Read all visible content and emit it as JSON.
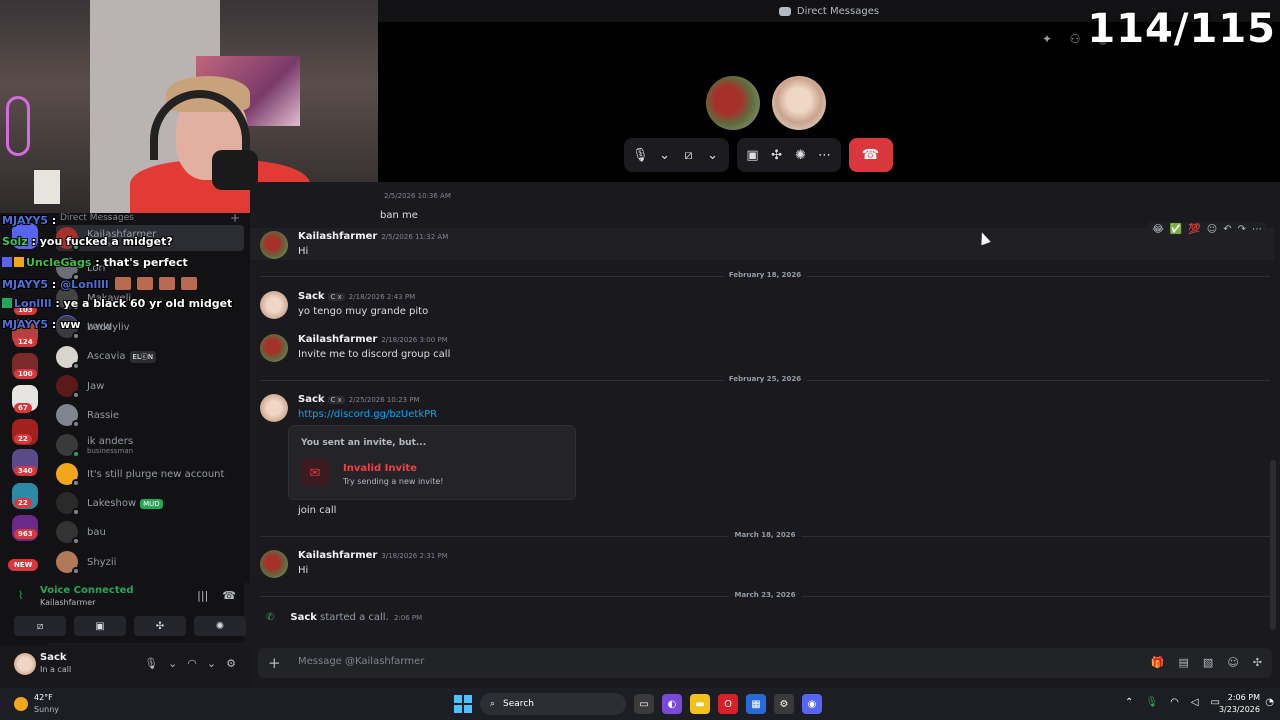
{
  "window": {
    "title": "Direct Messages",
    "counter": "114/115"
  },
  "dm_sidebar": {
    "header": "Direct Messages",
    "items": [
      {
        "name": "Kailashfarmer",
        "sub": "In a call",
        "active": true,
        "online": true
      },
      {
        "name": "Lori",
        "sub": "",
        "online": false
      },
      {
        "name": "Makaveli",
        "sub": "",
        "online": false
      },
      {
        "name": "www",
        "sub": "",
        "online": false
      },
      {
        "name": "baddyliv",
        "sub": "",
        "online": false
      },
      {
        "name": "Ascavia",
        "tag": "ELⓒN",
        "online": false
      },
      {
        "name": "Jaw",
        "sub": "",
        "online": false
      },
      {
        "name": "Rassie",
        "sub": "",
        "online": false
      },
      {
        "name": "ik anders",
        "sub": "businessman",
        "online": true
      },
      {
        "name": "It's still plurge new account",
        "sub": "",
        "online": false
      },
      {
        "name": "Lakeshow",
        "tag": "MUD",
        "online": false
      },
      {
        "name": "bau",
        "sub": "",
        "online": false
      },
      {
        "name": "Shyzii",
        "sub": "",
        "online": false
      }
    ]
  },
  "server_badges": [
    "103",
    "124",
    "100",
    "67",
    "22",
    "340",
    "22",
    "963"
  ],
  "server_new": "NEW",
  "stream_chat": [
    {
      "user": "MJAYY5",
      "text": "",
      "color": "u1"
    },
    {
      "user": "Solz",
      "text": "you fucked a midget?",
      "color": "u3"
    },
    {
      "user": "UncleGags",
      "text": "that's perfect",
      "color": "u2"
    },
    {
      "user": "MJAYY5",
      "text": "@Lonllll",
      "color": "u1"
    },
    {
      "user": "Lonllll",
      "text": "ye a black 60 yr old midget",
      "color": "u1"
    },
    {
      "user": "MJAYY5",
      "text": "ww",
      "color": "u1"
    }
  ],
  "voice_panel": {
    "status": "Voice Connected",
    "channel": "Kailashfarmer"
  },
  "user_panel": {
    "name": "Sack",
    "status": "In a call"
  },
  "messages": {
    "top_partial": {
      "time": "2/5/2026 10:36 AM",
      "text": "ban me"
    },
    "m1": {
      "user": "Kailashfarmer",
      "time": "2/5/2026 11:32 AM",
      "text": "Hi"
    },
    "d1": "February 18, 2026",
    "m2": {
      "user": "Sack",
      "tag": "C x",
      "time": "2/18/2026 2:43 PM",
      "text": "yo tengo muy grande pito"
    },
    "m3": {
      "user": "Kailashfarmer",
      "time": "2/18/2026 3:00 PM",
      "text": "Invite me to discord group call"
    },
    "d2": "February 25, 2026",
    "m4": {
      "user": "Sack",
      "tag": "C x",
      "time": "2/25/2026 10:23 PM",
      "link": "https://discord.gg/bzUetkPR",
      "after": "join call"
    },
    "invite": {
      "title": "You sent an invite, but...",
      "heading": "Invalid Invite",
      "sub": "Try sending a new invite!"
    },
    "d3": "March 18, 2026",
    "m5": {
      "user": "Kailashfarmer",
      "time": "3/18/2026 2:31 PM",
      "text": "Hi"
    },
    "d4": "March 23, 2026",
    "call": {
      "user": "Sack",
      "text": "started a call.",
      "time": "2:06 PM"
    }
  },
  "composer": {
    "placeholder": "Message @Kailashfarmer"
  },
  "taskbar": {
    "temp": "42°F",
    "condition": "Sunny",
    "search": "Search",
    "time": "2:06 PM",
    "date": "3/23/2026"
  }
}
